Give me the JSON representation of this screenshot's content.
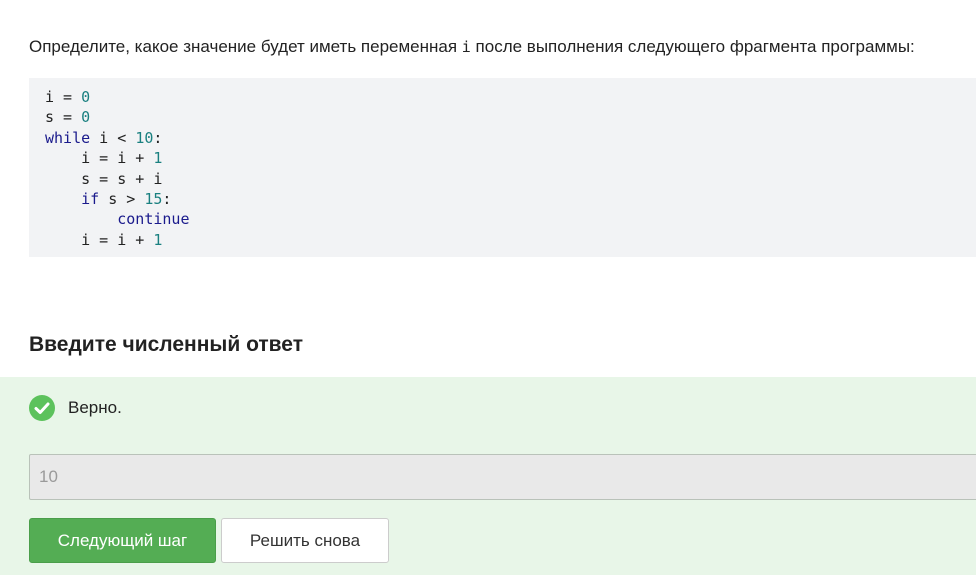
{
  "question": {
    "text_before": "Определите, какое значение будет иметь переменная ",
    "variable": "i",
    "text_after": " после выполнения следующего фрагмента программы:"
  },
  "code": {
    "lines": [
      [
        {
          "t": "txt",
          "v": "i = "
        },
        {
          "t": "num",
          "v": "0"
        }
      ],
      [
        {
          "t": "txt",
          "v": "s = "
        },
        {
          "t": "num",
          "v": "0"
        }
      ],
      [
        {
          "t": "kw",
          "v": "while"
        },
        {
          "t": "txt",
          "v": " i < "
        },
        {
          "t": "num",
          "v": "10"
        },
        {
          "t": "txt",
          "v": ":"
        }
      ],
      [
        {
          "t": "txt",
          "v": "    i = i + "
        },
        {
          "t": "num",
          "v": "1"
        }
      ],
      [
        {
          "t": "txt",
          "v": "    s = s + i"
        }
      ],
      [
        {
          "t": "txt",
          "v": "    "
        },
        {
          "t": "kw",
          "v": "if"
        },
        {
          "t": "txt",
          "v": " s > "
        },
        {
          "t": "num",
          "v": "15"
        },
        {
          "t": "txt",
          "v": ":"
        }
      ],
      [
        {
          "t": "txt",
          "v": "        "
        },
        {
          "t": "kw",
          "v": "continue"
        }
      ],
      [
        {
          "t": "txt",
          "v": "    i = i + "
        },
        {
          "t": "num",
          "v": "1"
        }
      ]
    ],
    "colors": {
      "keyword": "#1a1a8c",
      "number": "#1a8080",
      "text": "#222222",
      "background": "#f2f3f5"
    }
  },
  "answer_section": {
    "heading": "Введите численный ответ"
  },
  "feedback": {
    "status_icon": "check-circle-icon",
    "status_text": "Верно.",
    "status_color": "#5cc25c",
    "panel_color": "#e8f6e8"
  },
  "answer_input": {
    "value": "10"
  },
  "buttons": {
    "next_step_label": "Следующий шаг",
    "retry_label": "Решить снова",
    "primary_color": "#54ad54"
  }
}
